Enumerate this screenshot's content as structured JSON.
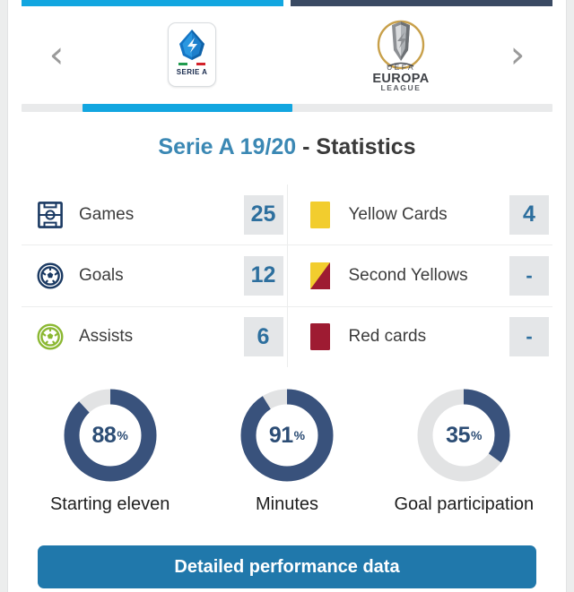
{
  "topbars": {
    "active_label": "active-competition-indicator",
    "inactive_label": "next-competition-indicator"
  },
  "carousel": {
    "prev_icon": "chevron-left-icon",
    "next_icon": "chevron-right-icon",
    "prev_glyph": "‹",
    "next_glyph": "›",
    "competitions": [
      {
        "name": "Serie A",
        "badge_text": "SERIE A",
        "selected": true
      },
      {
        "name": "Europa League",
        "line1": "UEFA",
        "line2": "EUROPA",
        "line3": "LEAGUE",
        "selected": false
      }
    ]
  },
  "heading": {
    "season": "Serie A 19/20",
    "separator": " - ",
    "label": "Statistics"
  },
  "stats": {
    "left_column": [
      {
        "icon": "pitch-icon",
        "label": "Games",
        "value": "25"
      },
      {
        "icon": "ball-icon",
        "label": "Goals",
        "value": "12"
      },
      {
        "icon": "assist-icon",
        "label": "Assists",
        "value": "6"
      }
    ],
    "right_column": [
      {
        "icon": "yellow-card-icon",
        "label": "Yellow Cards",
        "value": "4"
      },
      {
        "icon": "second-yellow-card-icon",
        "label": "Second Yellows",
        "value": "-"
      },
      {
        "icon": "red-card-icon",
        "label": "Red cards",
        "value": "-"
      }
    ]
  },
  "chart_data": {
    "type": "pie",
    "title": "Serie A 19/20 - Statistics",
    "legend": "none",
    "charts": [
      {
        "label": "Starting eleven",
        "value": 88,
        "unit": "%",
        "remainder": 12,
        "max": 100
      },
      {
        "label": "Minutes",
        "value": 91,
        "unit": "%",
        "remainder": 9,
        "max": 100
      },
      {
        "label": "Goal participation",
        "value": 35,
        "unit": "%",
        "remainder": 65,
        "max": 100
      }
    ],
    "colors": {
      "fill": "#39527c",
      "track": "#e2e3e4"
    }
  },
  "cta": {
    "label": "Detailed performance data"
  },
  "colors": {
    "accent_cyan": "#12a6e0",
    "accent_navy": "#3a4a63",
    "heading_blue": "#3b88b4",
    "value_blue": "#2d6f9e",
    "donut_navy": "#39527c",
    "button_blue": "#2078ab",
    "yellow_card": "#f2cd2e",
    "red_card": "#9e1b32",
    "assist_green": "#8bb832"
  }
}
